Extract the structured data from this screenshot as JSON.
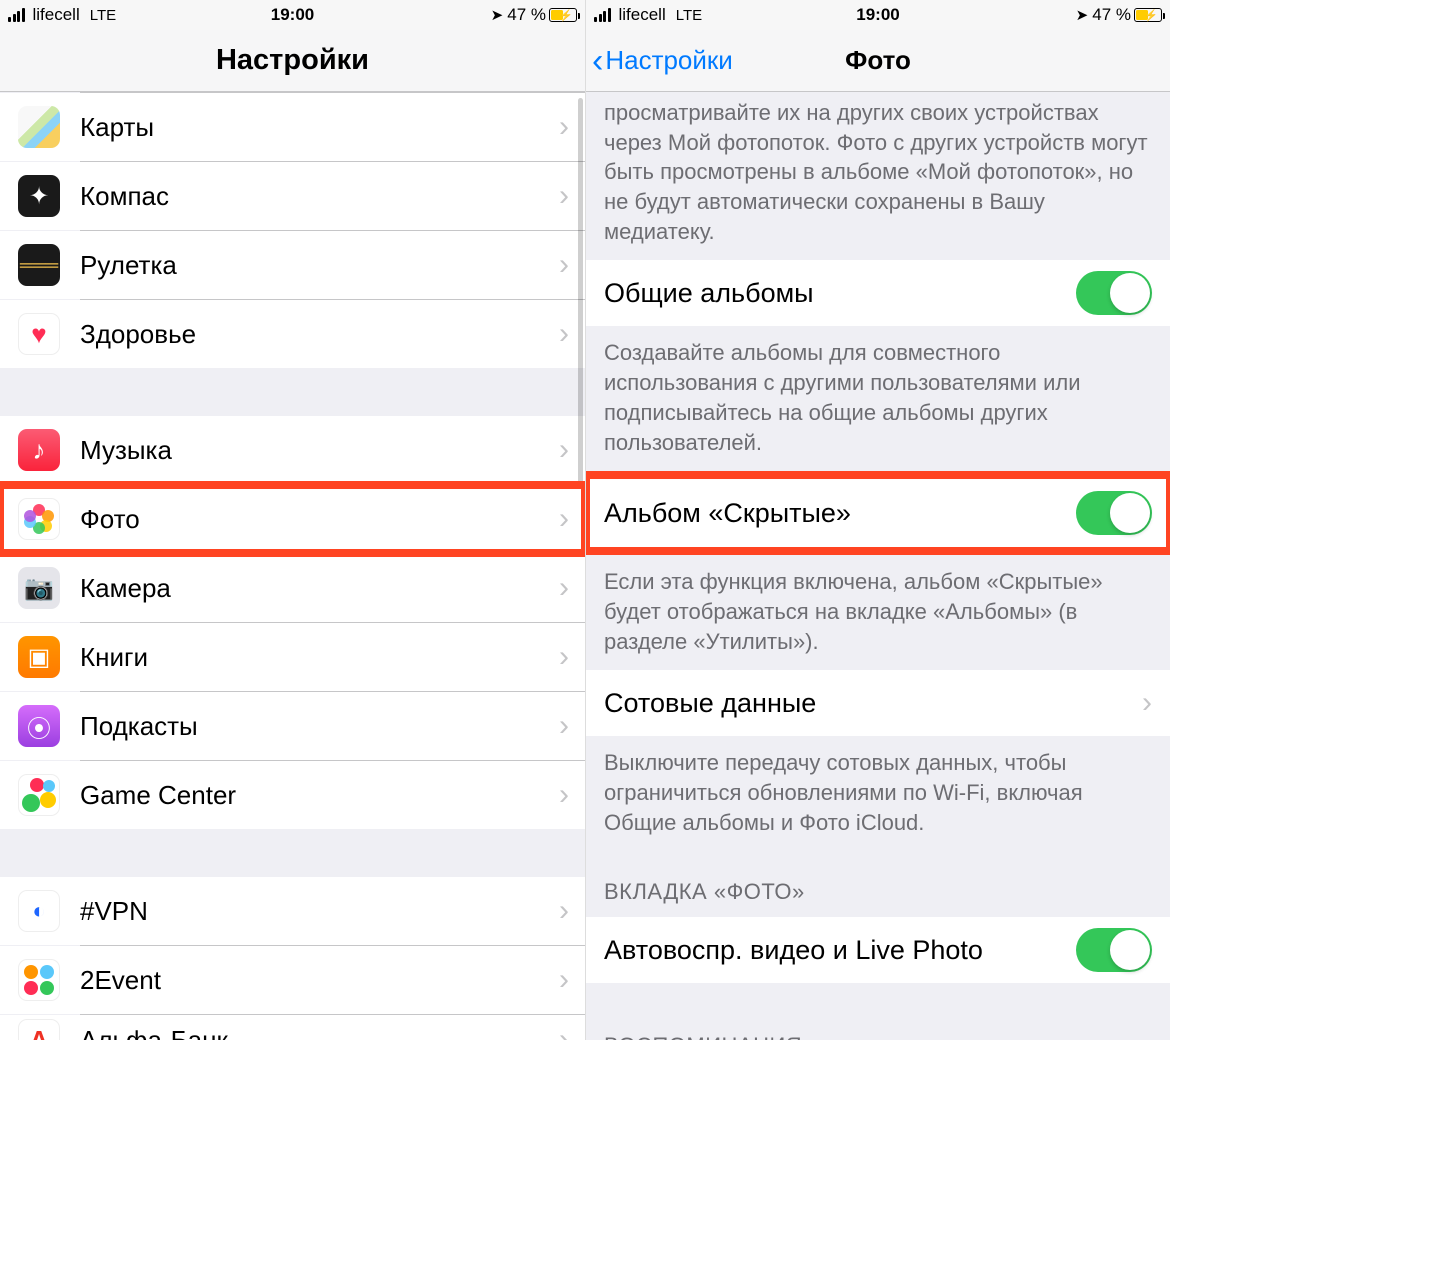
{
  "status": {
    "carrier": "lifecell",
    "network": "LTE",
    "time": "19:00",
    "battery_pct": "47 %",
    "location_glyph": "➤"
  },
  "left": {
    "title": "Настройки",
    "group1": [
      {
        "icon": "maps",
        "label": "Карты"
      },
      {
        "icon": "compass",
        "label": "Компас"
      },
      {
        "icon": "measure",
        "label": "Рулетка"
      },
      {
        "icon": "health",
        "label": "Здоровье"
      }
    ],
    "group2": [
      {
        "icon": "music",
        "label": "Музыка"
      },
      {
        "icon": "photos",
        "label": "Фото",
        "highlight": true
      },
      {
        "icon": "camera",
        "label": "Камера"
      },
      {
        "icon": "books",
        "label": "Книги"
      },
      {
        "icon": "podcasts",
        "label": "Подкасты"
      },
      {
        "icon": "gamecenter",
        "label": "Game Center"
      }
    ],
    "group3": [
      {
        "icon": "vpn",
        "label": "#VPN"
      },
      {
        "icon": "2event",
        "label": "2Event"
      },
      {
        "icon": "alfa",
        "label": "Альфа-Банк"
      }
    ]
  },
  "right": {
    "back_label": "Настройки",
    "title": "Фото",
    "top_footer": "просматривайте их на других своих устройствах через Мой фотопоток. Фото с других устройств могут быть просмотрены в альбоме «Мой фотопоток», но не будут автоматически сохранены в Вашу медиатеку.",
    "shared_albums_label": "Общие альбомы",
    "shared_albums_footer": "Создавайте альбомы для совместного использования с другими пользователями или подписывайтесь на общие альбомы других пользователей.",
    "hidden_album_label": "Альбом «Скрытые»",
    "hidden_album_footer": "Если эта функция включена, альбом «Скрытые» будет отображаться на вкладке «Альбомы» (в разделе «Утилиты»).",
    "cellular_label": "Сотовые данные",
    "cellular_footer": "Выключите передачу сотовых данных, чтобы ограничиться обновлениями по Wi-Fi, включая Общие альбомы и Фото iCloud.",
    "photos_tab_header": "ВКЛАДКА «ФОТО»",
    "autoplay_label": "Автовоспр. видео и Live Photo",
    "memories_header": "ВОСПОМИНАНИЯ"
  }
}
